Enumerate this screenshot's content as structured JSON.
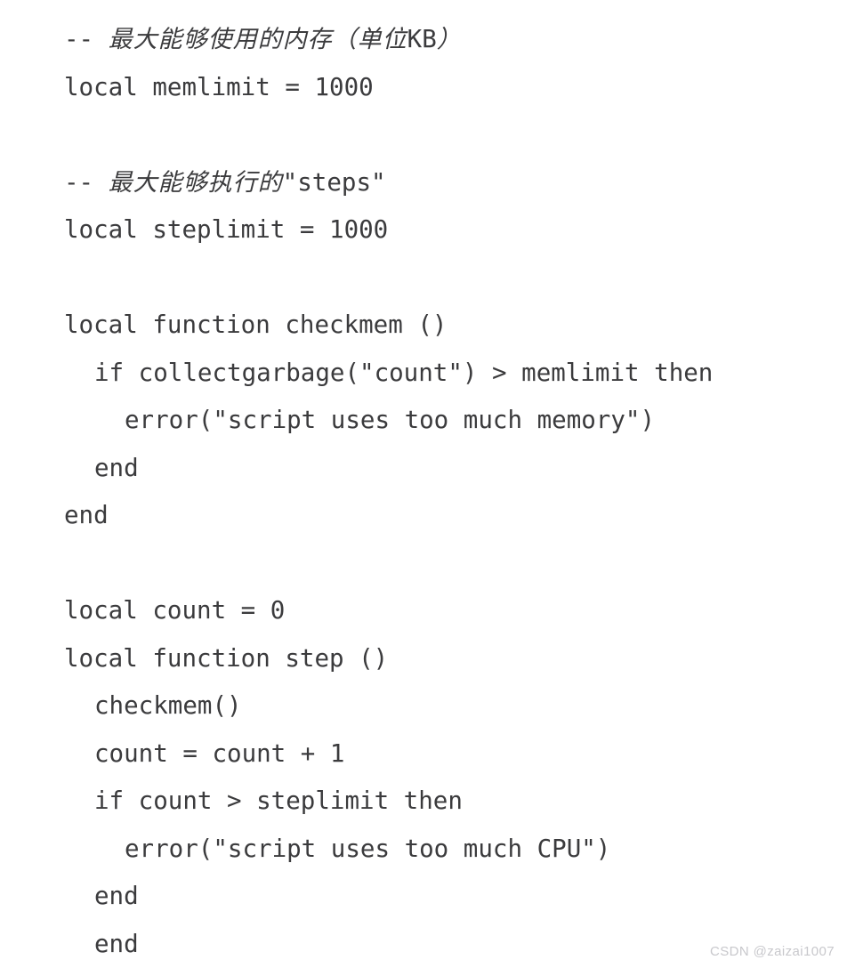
{
  "page": {
    "background_color": "#ffffff",
    "text_color": "#3b3b3d",
    "language": "lua",
    "watermark": "CSDN @zaizai1007",
    "watermark_color": "#c8c8cc"
  },
  "code": {
    "lines": [
      {
        "indent": 0,
        "text": "-- 最大能够使用的内存（单位KB）",
        "kind": "comment",
        "cjk": true
      },
      {
        "indent": 0,
        "text": "local memlimit = 1000",
        "kind": "code",
        "cjk": false
      },
      {
        "indent": 0,
        "text": "",
        "kind": "blank",
        "cjk": false
      },
      {
        "indent": 0,
        "text": "-- 最大能够执行的\"steps\"",
        "kind": "comment",
        "cjk": true
      },
      {
        "indent": 0,
        "text": "local steplimit = 1000",
        "kind": "code",
        "cjk": false
      },
      {
        "indent": 0,
        "text": "",
        "kind": "blank",
        "cjk": false
      },
      {
        "indent": 0,
        "text": "local function checkmem ()",
        "kind": "code",
        "cjk": false
      },
      {
        "indent": 1,
        "text": "if collectgarbage(\"count\") > memlimit then",
        "kind": "code",
        "cjk": false
      },
      {
        "indent": 2,
        "text": "error(\"script uses too much memory\")",
        "kind": "code",
        "cjk": false
      },
      {
        "indent": 1,
        "text": "end",
        "kind": "code",
        "cjk": false
      },
      {
        "indent": 0,
        "text": "end",
        "kind": "code",
        "cjk": false
      },
      {
        "indent": 0,
        "text": "",
        "kind": "blank",
        "cjk": false
      },
      {
        "indent": 0,
        "text": "local count = 0",
        "kind": "code",
        "cjk": false
      },
      {
        "indent": 0,
        "text": "local function step ()",
        "kind": "code",
        "cjk": false
      },
      {
        "indent": 1,
        "text": "checkmem()",
        "kind": "code",
        "cjk": false
      },
      {
        "indent": 1,
        "text": "count = count + 1",
        "kind": "code",
        "cjk": false
      },
      {
        "indent": 1,
        "text": "if count > steplimit then",
        "kind": "code",
        "cjk": false
      },
      {
        "indent": 2,
        "text": "error(\"script uses too much CPU\")",
        "kind": "code",
        "cjk": false
      },
      {
        "indent": 1,
        "text": "end",
        "kind": "code",
        "cjk": false
      },
      {
        "indent": 1,
        "text": "end",
        "kind": "code",
        "cjk": false
      }
    ]
  }
}
